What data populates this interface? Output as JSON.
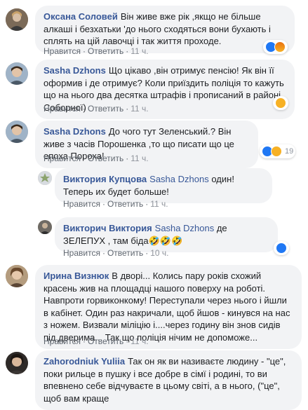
{
  "comments": [
    {
      "author": "Оксана Соловей",
      "text": "Він живе вже рік ,якщо не більше алкаші і безхатьки 'до нього сходяться вони бухають і сплять на цій лавочці і так життя проходе.",
      "like": "Нравится",
      "reply": "Ответить",
      "time": "11 ч.",
      "reactions": [
        "like",
        "angry"
      ]
    },
    {
      "author": "Sasha Dzhons",
      "text": "Що цікаво ,він отримує пенсію! Як він її оформив і де отримує? Коли приїздить поліція то кажуть що на нього два десятка штрафів і прописаний в районі Соборної)",
      "like": "Нравится",
      "reply": "Ответить",
      "time": "11 ч.",
      "reactions": [
        "wow"
      ]
    },
    {
      "author": "Sasha Dzhons",
      "text": "До чого тут Зеленський.? Він живе з часів Порошенка ,то що писати що це епоха Пороха!",
      "like": "Нравится",
      "reply": "Ответить",
      "time": "11 ч.",
      "reactions": [
        "like",
        "haha"
      ],
      "reaction_count": "19"
    },
    {
      "author": "Виктория Купцова",
      "mention": "Sasha Dzhons",
      "text": "один! Теперь их будет больше!",
      "like": "Нравится",
      "reply": "Ответить",
      "time": "11 ч."
    },
    {
      "author": "Викторич Виктория",
      "mention": "Sasha Dzhons",
      "text": "де ЗЕЛЕПУХ , там біда🤣🤣🤣",
      "like": "Нравится",
      "reply": "Ответить",
      "time": "10 ч.",
      "reactions": [
        "like"
      ]
    },
    {
      "author": "Ирина Визнюк",
      "text": "В дворі... Колись пару років схожий красень жив на площадці нашого поверху на роботі. Навпроти горвиконкому! Переступали через нього і йшли в кабінет. Один раз накричали, щоб йшов - кинувся на нас з ножем. Визвали міліцію і....через годину він знов сидів під дверима... Так що поліція нічим не допоможе...",
      "like": "Нравится",
      "reply": "Ответить",
      "time": "11 ч."
    },
    {
      "author": "Zahorodniuk Yuliia",
      "text": "Так он як ви називаєте людину - \"це\", поки рильце в пушку і все добре в сімї і родині, то ви впевнено себе відчуваєте в цьому світі, а в нього, (\"це\", щоб вам краще"
    }
  ],
  "colors": {
    "author": "#385898",
    "bubble": "#f2f3f5",
    "like": "#2078f4",
    "meta": "#606770"
  }
}
